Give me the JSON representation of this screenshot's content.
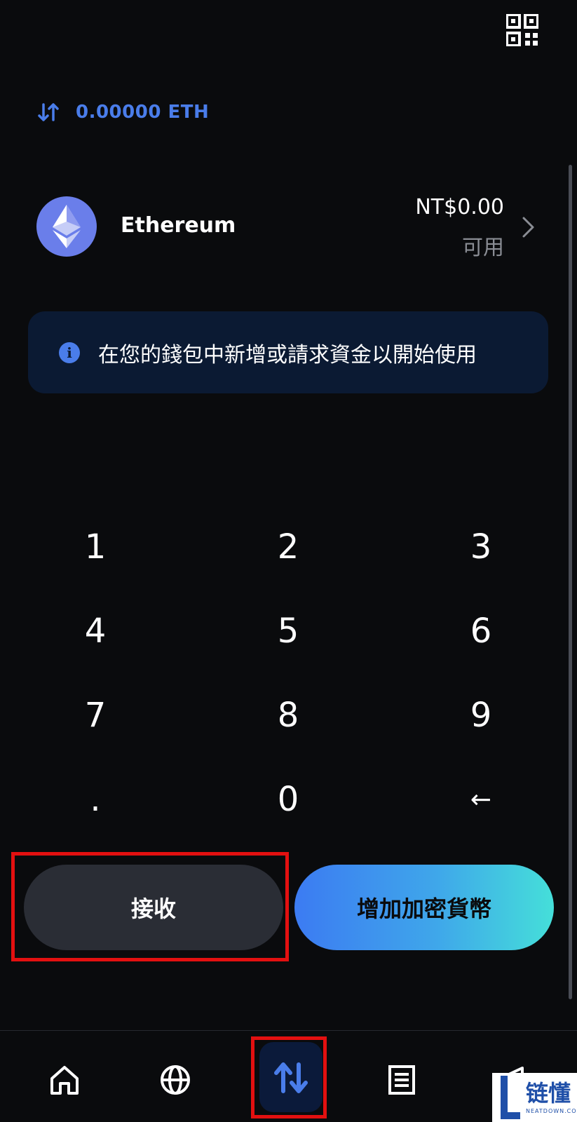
{
  "header": {
    "qr_icon": "qr-code-icon"
  },
  "amount": {
    "icon": "swap-icon",
    "text": "0.00000 ETH",
    "color": "#4a7dea"
  },
  "asset": {
    "icon": "ethereum-logo",
    "name": "Ethereum",
    "value": "NT$0.00",
    "available_label": "可用"
  },
  "info_banner": {
    "icon": "info-icon",
    "text": "在您的錢包中新增或請求資金以開始使用"
  },
  "keypad": {
    "keys": [
      "1",
      "2",
      "3",
      "4",
      "5",
      "6",
      "7",
      "8",
      "9",
      ".",
      "0",
      "←"
    ]
  },
  "actions": {
    "receive_label": "接收",
    "add_crypto_label": "增加加密貨幣"
  },
  "bottom_nav": {
    "items": [
      "home-icon",
      "globe-icon",
      "trade-icon",
      "list-icon",
      "send-icon"
    ]
  },
  "watermark": {
    "text": "链懂",
    "sub": "NEATDOWN.COM"
  },
  "colors": {
    "background": "#0a0b0d",
    "accent": "#4a7dea",
    "highlight": "#e31010"
  }
}
